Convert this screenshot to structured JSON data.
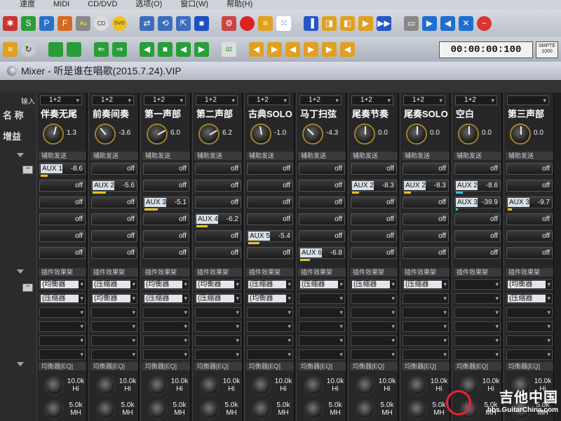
{
  "menubar": {
    "items": [
      "速度",
      "MIDI",
      "CD/DVD",
      "选项(O)",
      "窗口(W)",
      "帮助(H)"
    ]
  },
  "toolbar": {
    "time": "00:00:00:100",
    "smpte_line1": "SMPTE",
    "smpte_line2": "1000"
  },
  "mixer": {
    "title": "Mixer - 听是谁在唱歌(2015.7.24).VIP",
    "labels": {
      "input": "输入",
      "name": "名 称",
      "gain": "增益"
    },
    "channels": [
      {
        "input": "1+2",
        "name": "伴奏无尾",
        "gain": "1.3",
        "angle": 15
      },
      {
        "input": "1+2",
        "name": "前奏间奏",
        "gain": "-3.6",
        "angle": -40
      },
      {
        "input": "1+2",
        "name": "第一声部",
        "gain": "6.0",
        "angle": 60
      },
      {
        "input": "1+2",
        "name": "第二声部",
        "gain": "6.2",
        "angle": 60
      },
      {
        "input": "1+2",
        "name": "古典SOLO",
        "gain": "-1.0",
        "angle": -10
      },
      {
        "input": "1+2",
        "name": "马丁扫弦",
        "gain": "-4.3",
        "angle": -45
      },
      {
        "input": "1+2",
        "name": "尾奏节奏",
        "gain": "0.0",
        "angle": 0
      },
      {
        "input": "1+2",
        "name": "尾奏SOLO",
        "gain": "0.0",
        "angle": 0
      },
      {
        "input": "1+2",
        "name": "空白",
        "gain": "0.0",
        "angle": 0
      },
      {
        "input": "",
        "name": "第三声部",
        "gain": "0.0",
        "angle": 0
      }
    ],
    "section_headers": {
      "aux": "辅助发送",
      "fx": "插件效果架",
      "eq": "均衡器[EQ]"
    },
    "aux_sends": [
      [
        {
          "label": "AUX 1",
          "value": "-8.6",
          "bar": 0.15
        },
        {
          "value": "off"
        },
        {
          "value": "off"
        },
        {
          "value": "off"
        },
        {
          "value": "off"
        },
        {
          "value": "off"
        }
      ],
      [
        {
          "value": "off"
        },
        {
          "label": "AUX 2",
          "value": "-5.6",
          "bar": 0.3
        },
        {
          "value": "off"
        },
        {
          "value": "off"
        },
        {
          "value": "off"
        },
        {
          "value": "off"
        }
      ],
      [
        {
          "value": "off"
        },
        {
          "value": "off"
        },
        {
          "label": "AUX 3",
          "value": "-5.1",
          "bar": 0.3
        },
        {
          "value": "off"
        },
        {
          "value": "off"
        },
        {
          "value": "off"
        }
      ],
      [
        {
          "value": "off"
        },
        {
          "value": "off"
        },
        {
          "value": "off"
        },
        {
          "label": "AUX 4",
          "value": "-6.2",
          "bar": 0.25
        },
        {
          "value": "off"
        },
        {
          "value": "off"
        }
      ],
      [
        {
          "value": "off"
        },
        {
          "value": "off"
        },
        {
          "value": "off"
        },
        {
          "value": "off"
        },
        {
          "label": "AUX 5",
          "value": "-5.4",
          "bar": 0.25
        },
        {
          "value": "off"
        }
      ],
      [
        {
          "value": "off"
        },
        {
          "value": "off"
        },
        {
          "value": "off"
        },
        {
          "value": "off"
        },
        {
          "value": "off"
        },
        {
          "label": "AUX 6",
          "value": "-6.8",
          "bar": 0.22
        }
      ],
      [
        {
          "value": "off"
        },
        {
          "label": "AUX 2",
          "value": "-8.3",
          "bar": 0.15
        },
        {
          "value": "off"
        },
        {
          "value": "off"
        },
        {
          "value": "off"
        },
        {
          "value": "off"
        }
      ],
      [
        {
          "value": "off"
        },
        {
          "label": "AUX 2",
          "value": "-8.3",
          "bar": 0.15
        },
        {
          "value": "off"
        },
        {
          "value": "off"
        },
        {
          "value": "off"
        },
        {
          "value": "off"
        }
      ],
      [
        {
          "value": "off"
        },
        {
          "label": "AUX 2",
          "value": "-8.6",
          "bar": 0.15,
          "teal": true
        },
        {
          "label": "AUX 3",
          "value": "-39.9",
          "bar": 0.05,
          "teal": true
        },
        {
          "value": "off"
        },
        {
          "value": "off"
        },
        {
          "value": "off"
        }
      ],
      [
        {
          "value": "off"
        },
        {
          "value": "off"
        },
        {
          "label": "AUX 3",
          "value": "-9.7",
          "bar": 0.1
        },
        {
          "value": "off"
        },
        {
          "value": "off"
        },
        {
          "value": "off"
        }
      ]
    ],
    "fx": [
      [
        "(均衡器",
        "(压缩器"
      ],
      [
        "(压缩器",
        "(均衡器"
      ],
      [
        "(均衡器",
        "(压缩器"
      ],
      [
        "(均衡器",
        "(压缩器"
      ],
      [
        "(压缩器",
        "(均衡器"
      ],
      [
        "(压缩器",
        ""
      ],
      [
        "(压缩器",
        ""
      ],
      [
        "(压缩器",
        ""
      ],
      [
        "",
        ""
      ],
      [
        "(均衡器",
        "(压缩器"
      ]
    ],
    "eq": {
      "hi_freq": "10.0k",
      "hi_label": "Hi",
      "mh_freq": "5.0k",
      "mh_label": "MH"
    }
  },
  "watermark": {
    "title": "吉他中国",
    "url": "bbs.GuitarChina.com"
  }
}
